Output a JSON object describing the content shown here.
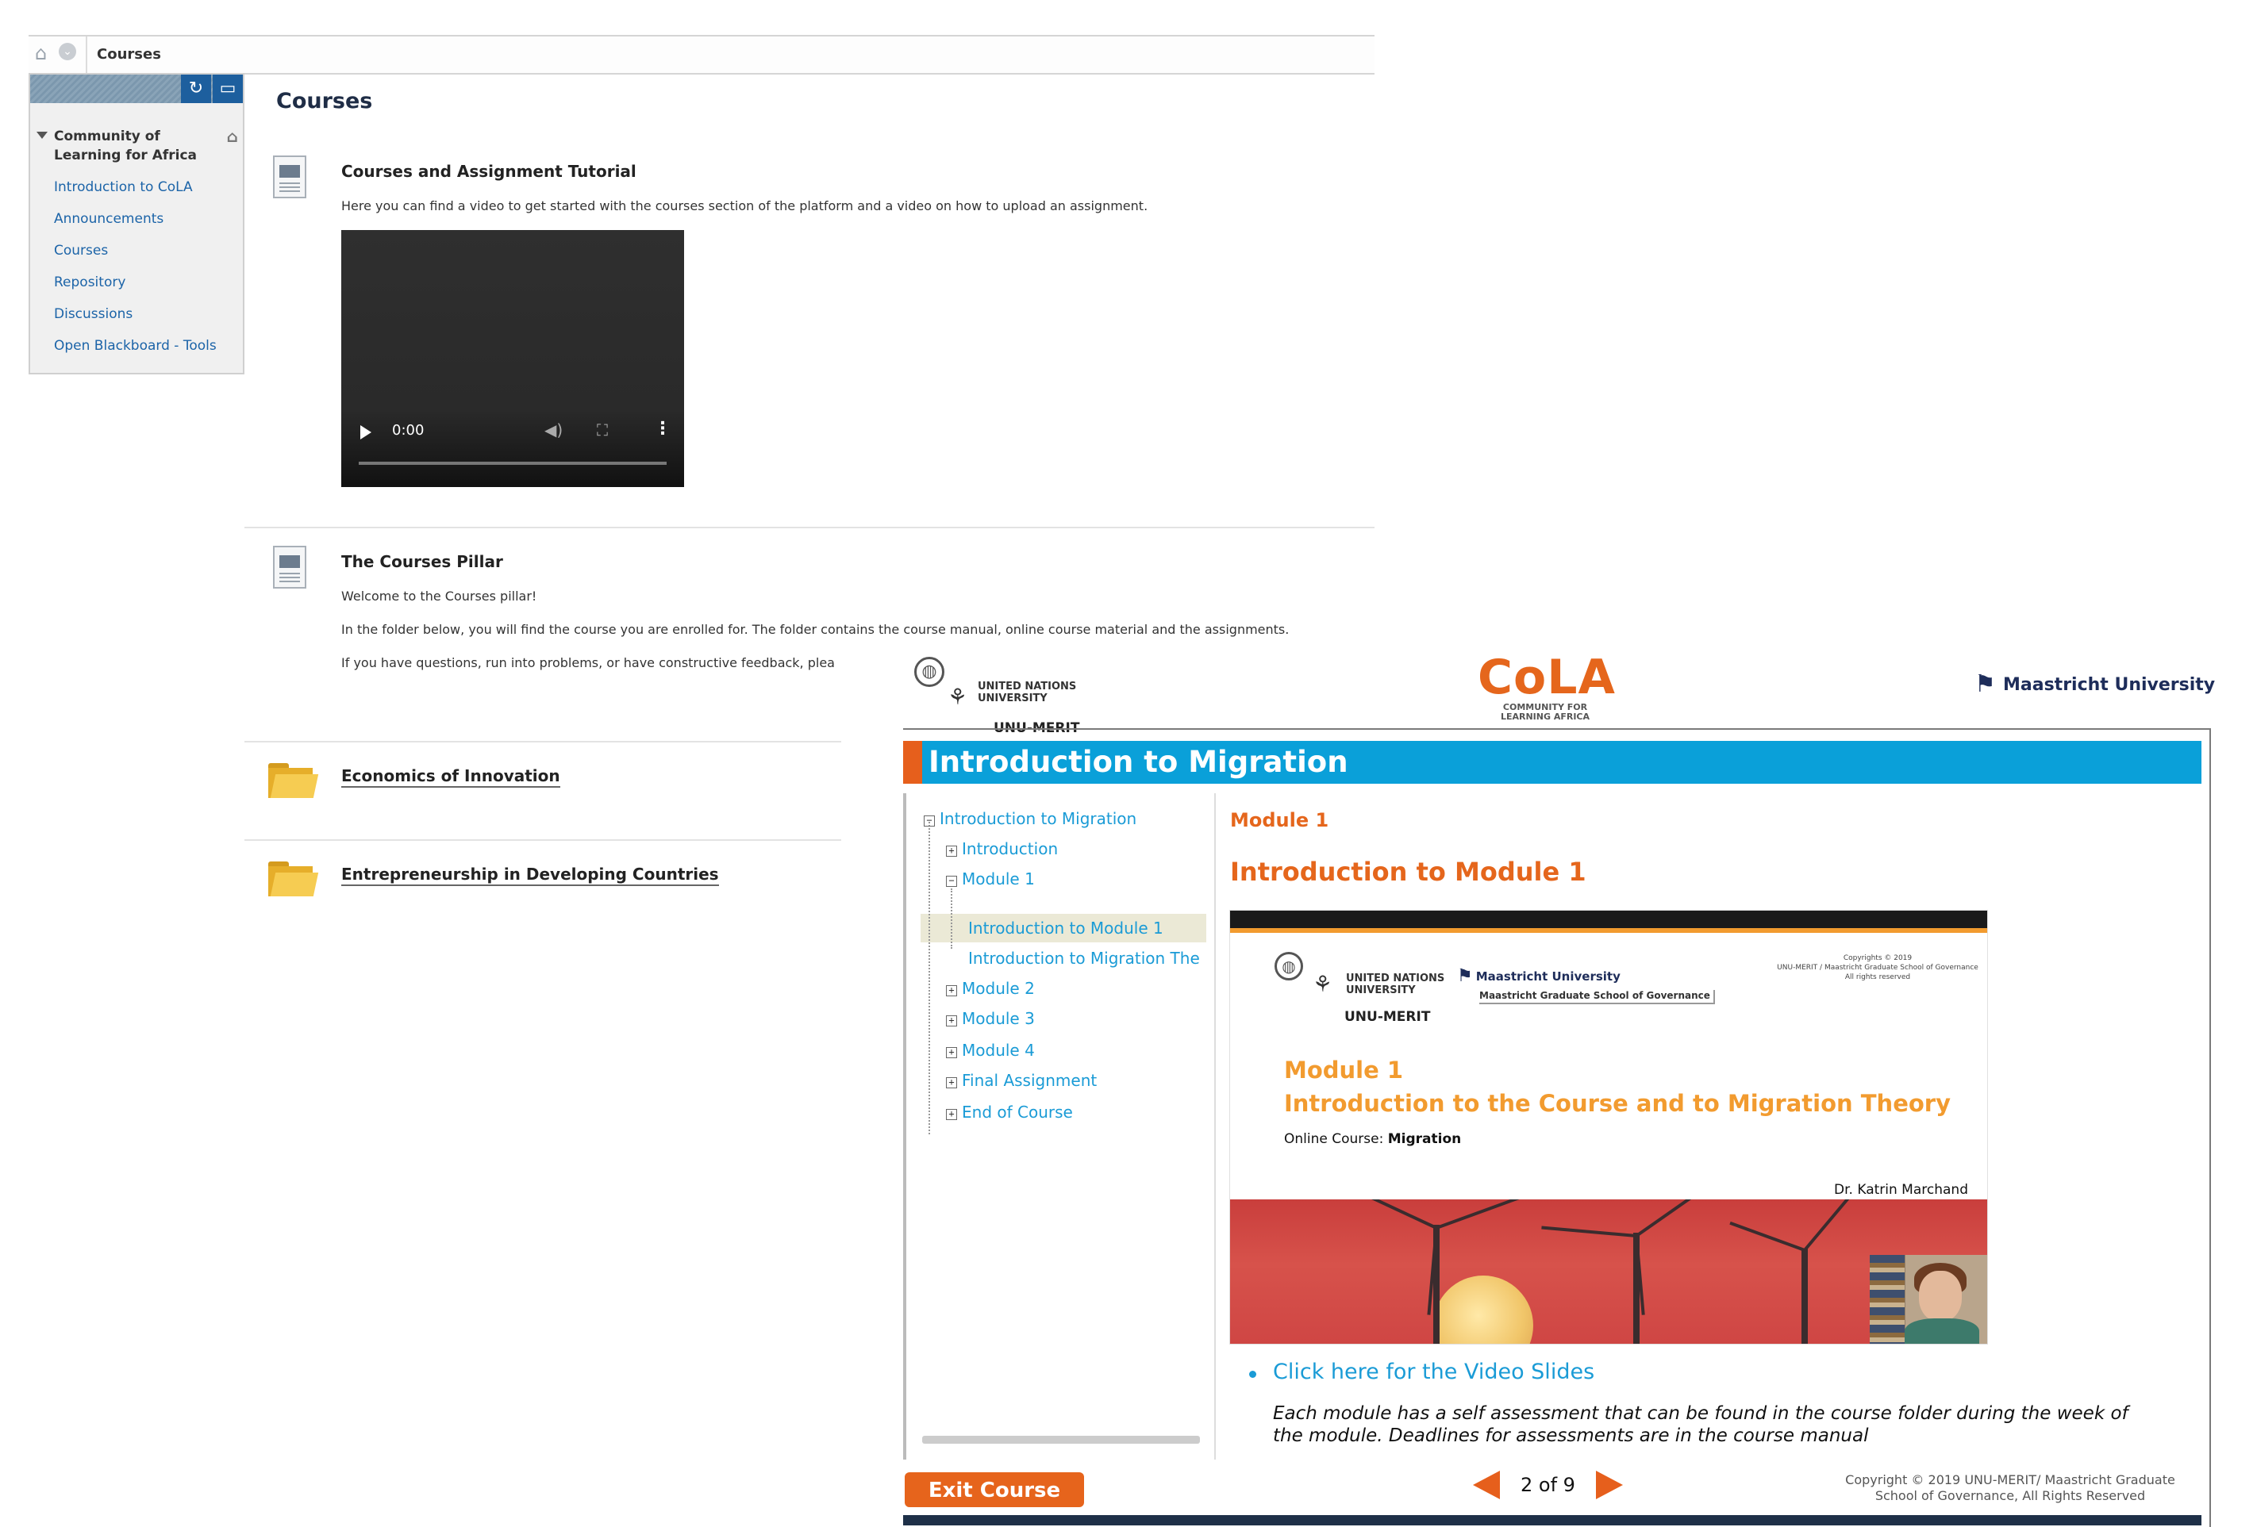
{
  "blackboard": {
    "breadcrumb": "Courses",
    "sidebar": {
      "course_name": "Community of Learning for Africa",
      "items": [
        {
          "label": "Introduction to CoLA"
        },
        {
          "label": "Announcements"
        },
        {
          "label": "Courses"
        },
        {
          "label": "Repository"
        },
        {
          "label": "Discussions"
        },
        {
          "label": "Open Blackboard - Tools"
        }
      ]
    },
    "page_title": "Courses",
    "items": [
      {
        "title": "Courses and Assignment Tutorial",
        "text": "Here you can find a video to get started with the courses section of the platform and a video on how to upload an assignment."
      },
      {
        "title": "The Courses Pillar",
        "lines": [
          "Welcome to the Courses pillar!",
          "In the folder below, you will find the course you are enrolled for. The folder contains the course manual, online course material and the assignments.",
          "If you have questions, run into problems, or have constructive feedback, plea"
        ]
      }
    ],
    "video": {
      "time": "0:00"
    },
    "folders": [
      {
        "label": "Economics of Innovation"
      },
      {
        "label": "Entrepreneurship in Developing Countries"
      }
    ]
  },
  "player": {
    "logos": {
      "un_line1": "UNITED NATIONS",
      "un_line2": "UNIVERSITY",
      "un_merit": "UNU-MERIT",
      "cola": "CoLA",
      "cola_sub1": "COMMUNITY FOR",
      "cola_sub2": "LEARNING AFRICA",
      "maastricht": "Maastricht University"
    },
    "course_title": "Introduction to Migration",
    "toc": [
      {
        "label": "Introduction to Migration",
        "sign": "−"
      },
      {
        "label": "Introduction",
        "sign": "+"
      },
      {
        "label": "Module 1",
        "sign": "−"
      },
      {
        "label": "Introduction to Module 1"
      },
      {
        "label": "Introduction to Migration The"
      },
      {
        "label": "Module 2",
        "sign": "+"
      },
      {
        "label": "Module 3",
        "sign": "+"
      },
      {
        "label": "Module 4",
        "sign": "+"
      },
      {
        "label": "Final Assignment",
        "sign": "+"
      },
      {
        "label": "End of Course",
        "sign": "+"
      }
    ],
    "content": {
      "module_label": "Module 1",
      "module_title": "Introduction to Module 1",
      "slide": {
        "un_line1": "UNITED NATIONS",
        "un_line2": "UNIVERSITY",
        "un_merit": "UNU-MERIT",
        "mu_name": "Maastricht University",
        "mu_sub": "Maastricht Graduate School of Governance",
        "copyright1": "Copyrights © 2019",
        "copyright2": "UNU-MERIT / Maastricht Graduate School of Governance",
        "copyright3": "All rights reserved",
        "module": "Module 1",
        "title": "Introduction to the Course and to Migration Theory",
        "course_prefix": "Online Course: ",
        "course_name": "Migration",
        "author": "Dr. Katrin Marchand"
      },
      "slides_link": "Click here for the Video Slides",
      "note": "Each module has a self assessment that can be found in the course folder during the week of the module. Deadlines for assessments are in the course manual"
    },
    "footer": {
      "exit": "Exit Course",
      "page_count": "2 of 9",
      "copyright": "Copyright © 2019 UNU-MERIT/ Maastricht Graduate School of Governance, All Rights Reserved"
    }
  },
  "colors": {
    "accent_orange": "#e5661c",
    "title_blue": "#0aa0d9",
    "link_blue": "#1a9bd6",
    "bb_link": "#1c64a8"
  }
}
